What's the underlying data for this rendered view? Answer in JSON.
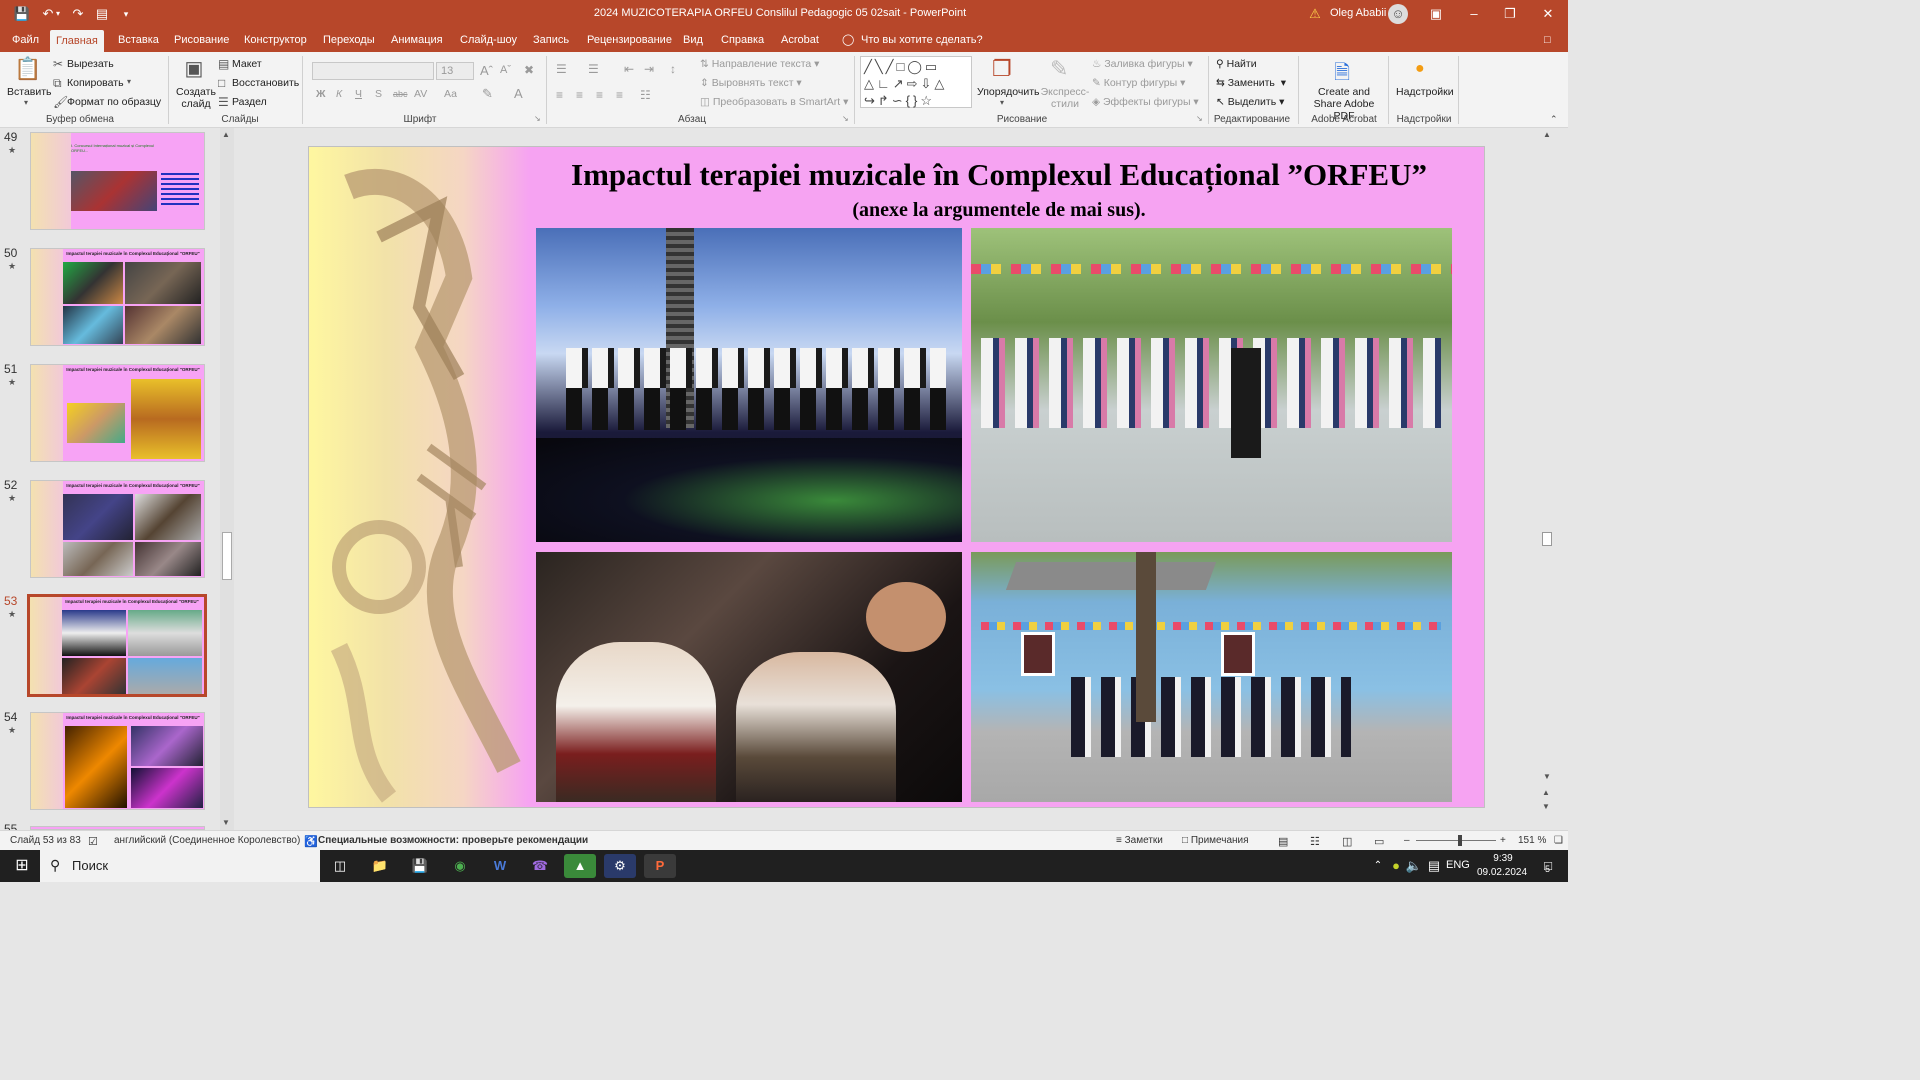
{
  "window": {
    "title": "2024 MUZICOTERAPIA ORFEU Conslilul Pedagogic 05 02sait  -  PowerPoint",
    "user": "Oleg Ababii",
    "warning_icon": "warning-icon"
  },
  "tabs": [
    "Файл",
    "Главная",
    "Вставка",
    "Рисование",
    "Конструктор",
    "Переходы",
    "Анимация",
    "Слайд-шоу",
    "Запись",
    "Рецензирование",
    "Вид",
    "Справка",
    "Acrobat"
  ],
  "tell_me": "Что вы хотите сделать?",
  "ribbon": {
    "clipboard": {
      "paste": "Вставить",
      "cut": "Вырезать",
      "copy": "Копировать",
      "format_painter": "Формат по образцу",
      "label": "Буфер обмена"
    },
    "slides": {
      "new_slide": "Создать слайд",
      "layout": "Макет",
      "reset": "Восстановить",
      "section": "Раздел",
      "label": "Слайды"
    },
    "font": {
      "size": "13",
      "label": "Шрифт",
      "bold": "Ж",
      "italic": "К",
      "underline": "Ч",
      "shadow": "S",
      "strike": "abc",
      "spacing": "AV",
      "case": "Аа"
    },
    "paragraph": {
      "text_direction": "Направление текста",
      "align_text": "Выровнять текст",
      "smartart": "Преобразовать в SmartArt",
      "label": "Абзац"
    },
    "drawing": {
      "arrange": "Упорядочить",
      "quick_styles": "Экспресс-стили",
      "fill": "Заливка фигуры",
      "outline": "Контур фигуры",
      "effects": "Эффекты фигуры",
      "label": "Рисование"
    },
    "editing": {
      "find": "Найти",
      "replace": "Заменить",
      "select": "Выделить",
      "label": "Редактирование"
    },
    "acrobat": {
      "create_share": "Create and Share Adobe PDF",
      "label": "Adobe Acrobat"
    },
    "addins": {
      "addins": "Надстройки",
      "label": "Надстройки"
    }
  },
  "thumbnails": [
    {
      "num": "49",
      "title": "I. Concursul Internațional muzical și Complexul ORFEU..."
    },
    {
      "num": "50",
      "title": "Impactul terapiei muzicale în Complexul Educațional \"ORFEU\""
    },
    {
      "num": "51",
      "title": "Impactul terapiei muzicale în Complexul Educațional \"ORFEU\""
    },
    {
      "num": "52",
      "title": "Impactul terapiei muzicale în Complexul Educațional \"ORFEU\""
    },
    {
      "num": "53",
      "title": "Impactul terapiei muzicale în Complexul Educațional \"ORFEU\""
    },
    {
      "num": "54",
      "title": "Impactul terapiei muzicale în Complexul Educațional \"ORFEU\""
    },
    {
      "num": "55",
      "title": ""
    }
  ],
  "slide": {
    "title": "Impactul terapiei muzicale în Complexul Educațional ”ORFEU”",
    "subtitle": "(anexe la argumentele de mai sus).",
    "bg_color": "#f6a3f2"
  },
  "status": {
    "slide_of": "Слайд 53 из 83",
    "language": "английский (Соединенное Королевство)",
    "accessibility": "Специальные возможности: проверьте рекомендации",
    "notes": "Заметки",
    "comments": "Примечания",
    "zoom": "151 %"
  },
  "taskbar": {
    "search": "Поиск",
    "lang": "ENG",
    "time": "9:39",
    "date": "09.02.2024",
    "notif_count": "5"
  },
  "colors": {
    "accent": "#b7472a",
    "slide_bg": "#f6a3f2"
  }
}
